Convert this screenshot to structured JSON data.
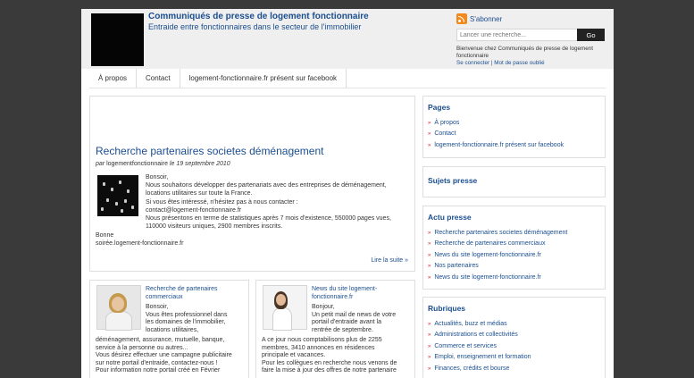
{
  "header": {
    "site_title": "Communiqués de presse de logement fonctionnaire",
    "site_description": "Entraide entre fonctionnaires dans le secteur de l'immobilier",
    "subscribe_label": "S'abonner",
    "search": {
      "placeholder": "Lancer une recherche...",
      "button_label": "Go"
    },
    "welcome": "Bienvenue chez Communiqués de presse de logement fonctionnaire",
    "login_link": "Se connecter",
    "separator": "|",
    "lost_password_link": "Mot de passe oublié"
  },
  "nav": {
    "items": [
      "À propos",
      "Contact",
      "logement-fonctionnaire.fr présent sur facebook"
    ]
  },
  "featured_post": {
    "title": "Recherche partenaires societes déménagement",
    "by": "par",
    "author": "logementfonctionnaire",
    "date_prefix": "le",
    "date": "19 septembre 2010",
    "body": "Bonsoir,\nNous souhaitons développer des partenariats avec des entreprises de déménagement,\nlocations utilitaires sur toute la France.\nSi vous êtes intéressé, n'hésitez pas à nous contacter :\ncontact@logement-fonctionnaire.fr\nNous présentons en terme de statistiques après 7 mois d'existence, 550000 pages vues,\n110000 visiteurs uniques, 2900 membres inscrits.",
    "tail": "Bonne\nsoirée.logement-fonctionnaire.fr",
    "read_more": "Lire la suite »"
  },
  "posts": [
    {
      "title": "Recherche de partenaires commerciaux",
      "body": "Bonsoir,\nVous êtes professionnel dans\nles domaines de l'immobilier,\nlocations utilitaires,",
      "body_cont": "déménagement, assurance, mutuelle, banque,\nservice à la personne ou autres...\nVous désirez effectuer une campagne publicitaire\nsur notre portail d'entraide, contactez-nous !\nPour information notre portail créé en Février"
    },
    {
      "title": "News du site logement-fonctionnaire.fr",
      "body": "Bonjour,\nUn petit mail de news de votre\nportail d'entraide avant la\nrentrée de septembre.",
      "body_cont": "A ce jour nous comptabilisons plus de 2255\nmembres, 3410 annonces en résidences\nprincipale et vacances.\nPour les collègues en recherche nous venons de\nfaire la mise à jour des offres de notre partenaire"
    }
  ],
  "sidebar": {
    "pages": {
      "title": "Pages",
      "items": [
        "À propos",
        "Contact",
        "logement-fonctionnaire.fr présent sur facebook"
      ]
    },
    "subjects": {
      "title": "Sujets presse"
    },
    "news": {
      "title": "Actu presse",
      "items": [
        "Recherche partenaires societes déménagement",
        "Recherche de partenaires commerciaux",
        "News du site logement-fonctionnaire.fr",
        "Nos partenaires",
        "News du site logement-fonctionnaire.fr"
      ]
    },
    "categories": {
      "title": "Rubriques",
      "items": [
        "Actualités, buzz et médias",
        "Administrations et collectivités",
        "Commerce et services",
        "Emploi, enseignement et formation",
        "Finances, crédits et bourse"
      ]
    }
  },
  "colors": {
    "link": "#1b4e8f",
    "bullet": "#d2232a",
    "header_bg": "#efefef",
    "backdrop": "#3a3a3a"
  }
}
